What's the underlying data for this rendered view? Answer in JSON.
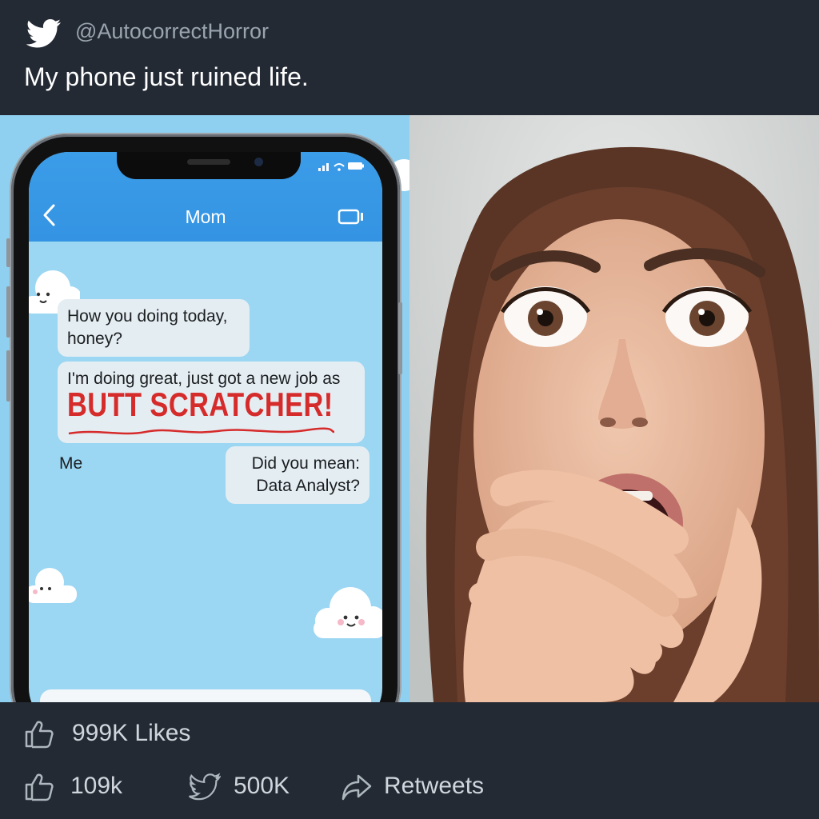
{
  "tweet": {
    "handle": "@AutocorrectHorror",
    "text": "My phone just ruined life."
  },
  "phone": {
    "contact_name": "Mom",
    "messages": [
      {
        "text": "How you doing today, honey?"
      },
      {
        "text": "I'm doing great, just got a new job as"
      },
      {
        "text": "BUTT SCRATCHER!"
      },
      {
        "text": "Did you mean: Data Analyst?"
      }
    ],
    "sender_label": "Me"
  },
  "footer": {
    "likes": "999K Likes",
    "replies": "109k",
    "retweets_count": "500K",
    "retweets_label": "Retweets"
  },
  "icons": {
    "brand": "twitter-bird-icon",
    "back": "chevron-left-icon",
    "video": "video-call-icon",
    "like": "thumbs-up-icon",
    "retweet": "twitter-bird-icon",
    "share": "share-arrow-icon"
  },
  "colors": {
    "background": "#1f2833",
    "phone_screen": "#9bd6f3",
    "appbar": "#3494e3",
    "highlight_red": "#d62b2b"
  }
}
